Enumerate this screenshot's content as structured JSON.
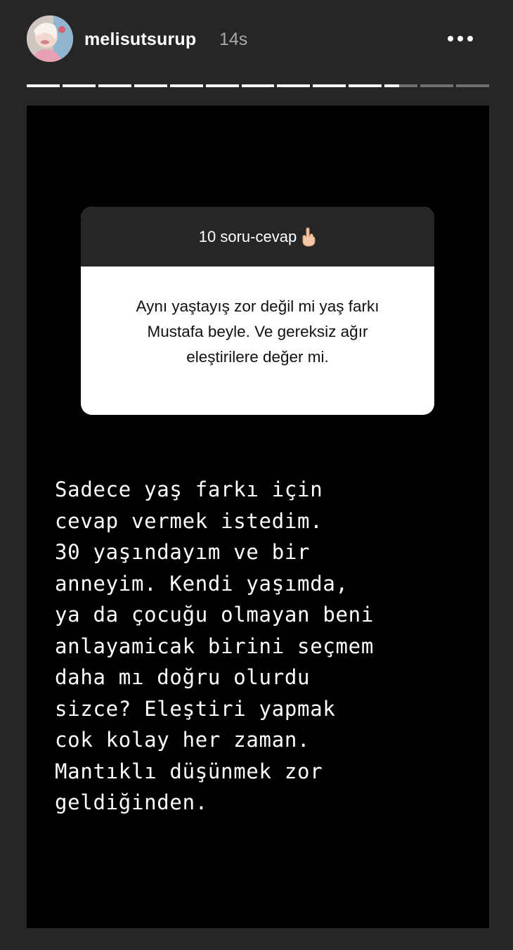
{
  "header": {
    "avatar_icon": "profile-photo",
    "username": "melisutsurup",
    "timestamp": "14s",
    "more_icon": "more-horizontal-icon"
  },
  "progress": {
    "segment_count": 13,
    "completed_segments": 10,
    "current_segment_progress": 0.45
  },
  "question_sticker": {
    "title": "10 soru-cevap",
    "title_icon": "backhand-index-pointing-down-icon",
    "question": "Aynı yaştayış zor değil mi yaş farkı  Mustafa beyle. Ve gereksiz ağır eleştirilere değer mi."
  },
  "answer": {
    "text": "Sadece yaş farkı için\ncevap vermek istedim.\n30 yaşındayım ve bir\nanneyim. Kendi yaşımda,\nya da çocuğu olmayan beni\nanlayamicak birini seçmem\ndaha mı doğru olurdu\nsizce? Eleştiri yapmak\ncok kolay her zaman.\nMantıklı düşünmek zor\ngeldiğinden."
  },
  "colors": {
    "page_background": "#262626",
    "story_background": "#000000",
    "sticker_header": "#262626",
    "sticker_body": "#ffffff",
    "text_primary": "#ffffff",
    "text_secondary": "#a8a8a8"
  }
}
